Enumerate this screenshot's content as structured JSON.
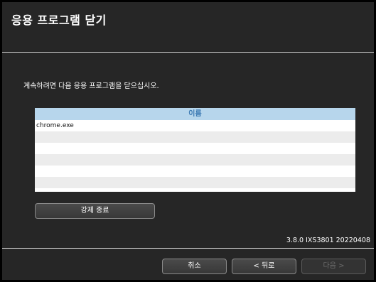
{
  "dialog": {
    "title": "응용 프로그램 닫기",
    "instruction": "계속하려면 다음 응용 프로그램을 닫으십시오.",
    "list": {
      "column_header": "이름",
      "rows": [
        "chrome.exe",
        "",
        "",
        "",
        "",
        ""
      ]
    },
    "force_close_label": "강제 종료",
    "version": "3.8.0 IXS3801 20220408",
    "buttons": {
      "cancel": "취소",
      "back": "< 뒤로",
      "next": "다음 >"
    }
  }
}
